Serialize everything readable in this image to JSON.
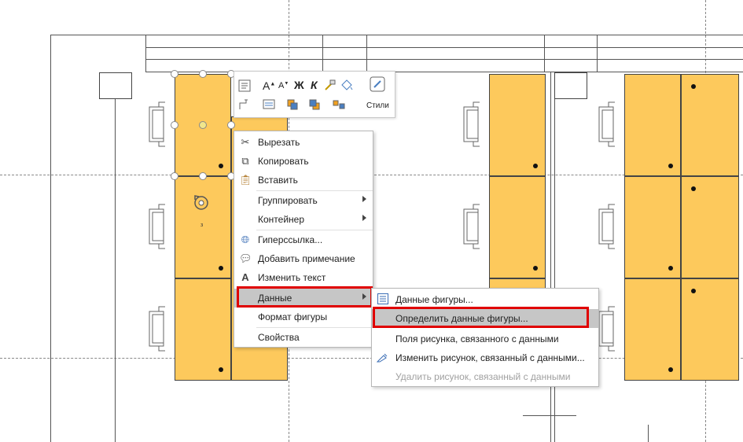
{
  "context_menu": {
    "items": [
      {
        "label": "Вырезать",
        "icon": "scissors-icon"
      },
      {
        "label": "Копировать",
        "icon": "copy-icon"
      },
      {
        "label": "Вставить",
        "icon": "paste-icon"
      },
      {
        "label": "Группировать",
        "submenu": true
      },
      {
        "label": "Контейнер",
        "submenu": true
      },
      {
        "label": "Гиперссылка...",
        "icon": "hyperlink-icon"
      },
      {
        "label": "Добавить примечание",
        "icon": "comment-icon"
      },
      {
        "label": "Изменить текст",
        "icon": "text-a-icon"
      },
      {
        "label": "Данные",
        "submenu": true,
        "highlighted": true
      },
      {
        "label": "Формат фигуры"
      },
      {
        "label": "Свойства"
      }
    ]
  },
  "data_submenu": {
    "items": [
      {
        "label": "Данные фигуры...",
        "icon": "shape-data-icon"
      },
      {
        "label": "Определить данные фигуры...",
        "highlighted": true
      },
      {
        "label": "Поля рисунка, связанного с данными"
      },
      {
        "label": "Изменить рисунок, связанный с данными...",
        "icon": "edit-graphic-icon"
      },
      {
        "label": "Удалить рисунок, связанный с данными",
        "disabled": true
      }
    ]
  },
  "mini_toolbar": {
    "bold": "Ж",
    "italic": "К",
    "font_grow": "A",
    "font_shrink": "A",
    "styles_label": "Стили"
  },
  "shape_label_small": "з",
  "colors": {
    "desk_fill": "#fdc95c",
    "highlight_border": "#e00000",
    "menu_highlight": "#c6c6c6"
  }
}
